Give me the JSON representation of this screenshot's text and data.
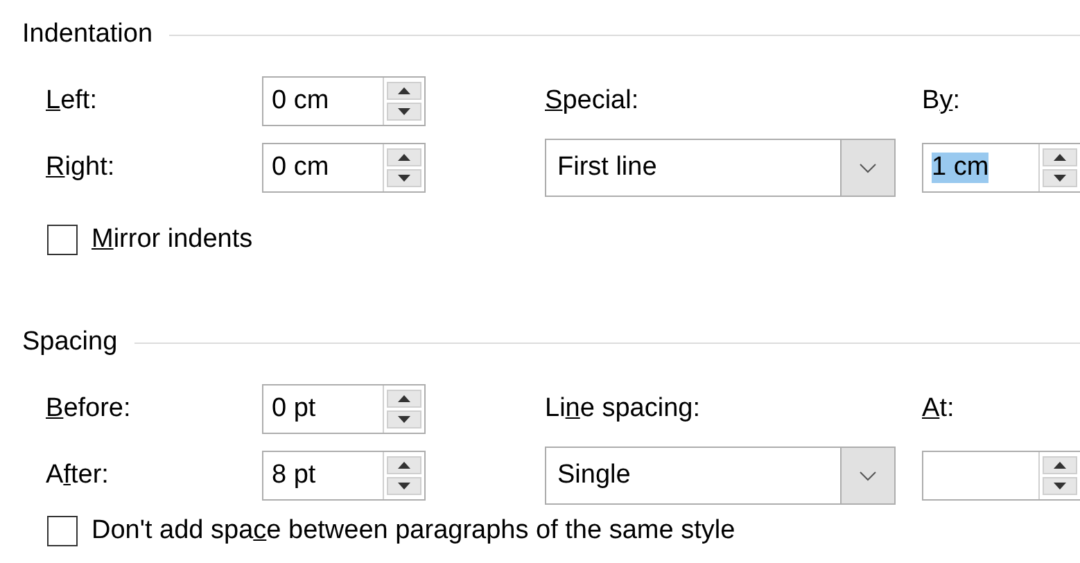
{
  "sections": [
    {
      "title": "Indentation",
      "fields": [
        {
          "label": {
            "key": "L",
            "post": "eft:"
          },
          "value": "0 cm"
        },
        {
          "label": {
            "key": "R",
            "post": "ight:"
          },
          "value": "0 cm"
        }
      ],
      "dropdown": {
        "label": {
          "key": "S",
          "post": "pecial:"
        },
        "value": "First line"
      },
      "amount": {
        "label": {
          "pre": "B",
          "key": "y",
          "post": ":"
        },
        "value": "1 cm",
        "highlighted": true
      },
      "checkbox": {
        "label": {
          "key": "M",
          "post": "irror indents"
        },
        "checked": false
      }
    },
    {
      "title": "Spacing",
      "fields": [
        {
          "label": {
            "key": "B",
            "post": "efore:"
          },
          "value": "0 pt"
        },
        {
          "label": {
            "pre": "A",
            "key": "f",
            "post": "ter:"
          },
          "value": "8 pt"
        }
      ],
      "dropdown": {
        "label": {
          "pre": "Li",
          "key": "n",
          "post": "e spacing:"
        },
        "value": "Single"
      },
      "amount": {
        "label": {
          "key": "A",
          "post": "t:"
        }
      },
      "checkbox": {
        "label": {
          "pre": "Don't add spa",
          "key": "c",
          "post": "e between paragraphs of the same style"
        },
        "checked": false
      }
    }
  ]
}
